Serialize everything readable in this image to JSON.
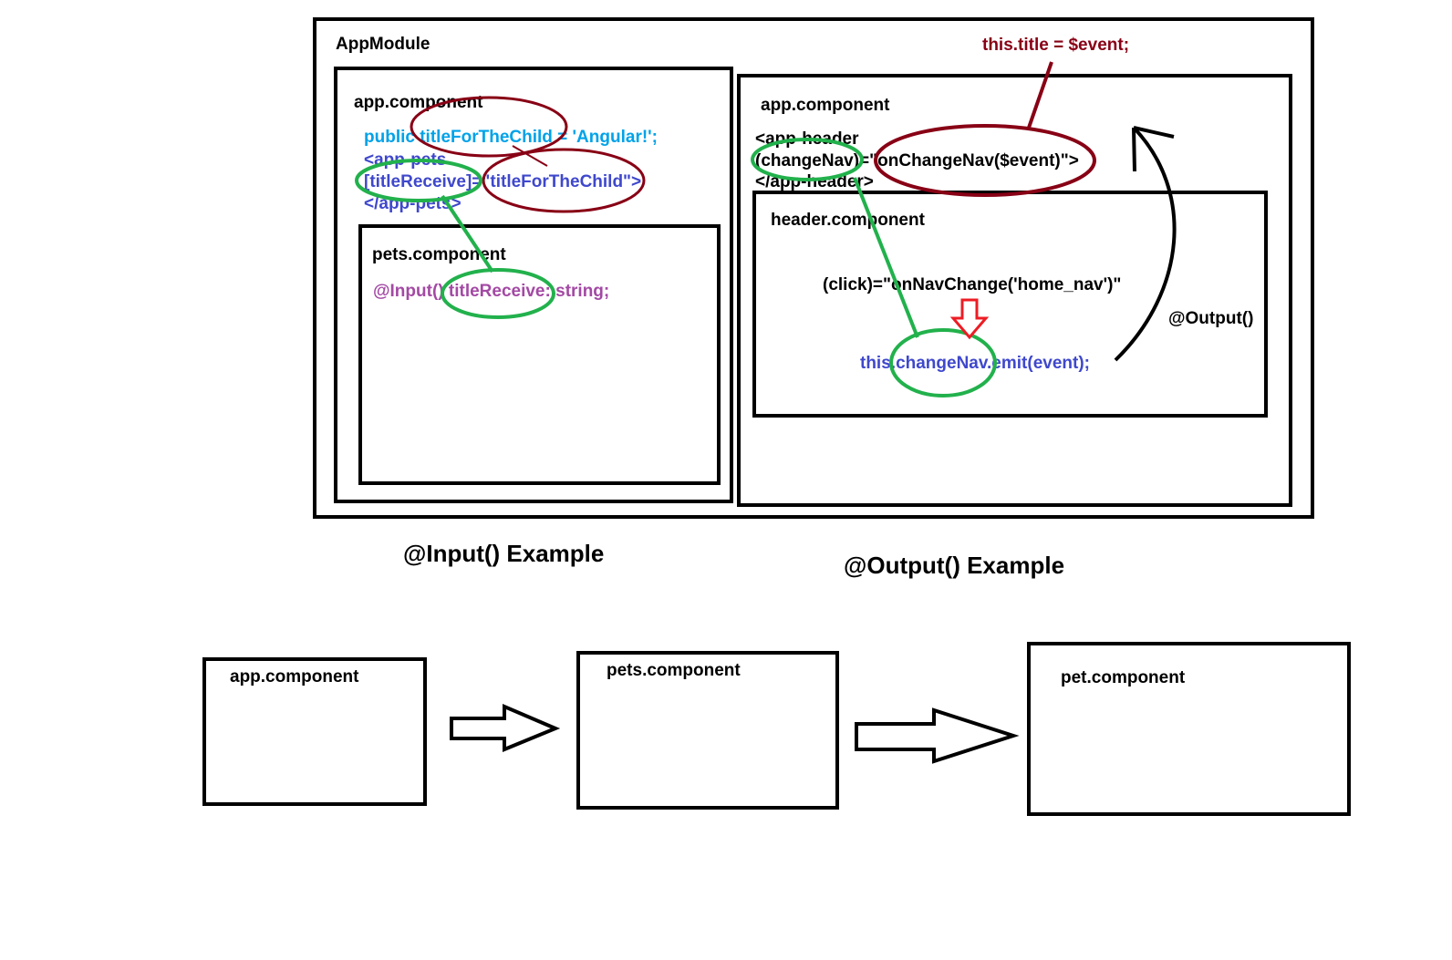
{
  "colors": {
    "code_light": "#00a2e8",
    "code_blue": "#3f48cc",
    "code_purple": "#a349a4",
    "event_red": "#880015",
    "link_green": "#22b14c",
    "arrow_red": "#ed1c24"
  },
  "app_module": {
    "label": "AppModule"
  },
  "input_panel": {
    "component_label": "app.component",
    "line1_keyword": "public",
    "line1_name": "titleForTheChild",
    "line1_value": " = 'Angular!';",
    "line2": "<app-pets",
    "line3_binding": "[titleReceive]",
    "line3_eq": "=",
    "line3_value": "\"titleForTheChild\">",
    "line4": "</app-pets>",
    "child_label": "pets.component",
    "child_decorator": "@Input()",
    "child_prop": "titleReceive",
    "child_type": ": string;"
  },
  "output_panel": {
    "assignment": "this.title = $event;",
    "component_label": "app.component",
    "line1": "<app-header",
    "line2_event": "(changeNav)",
    "line2_eq": "=",
    "line2_handler": "\"onChangeNav($event)\">",
    "line3": "</app-header>",
    "child_label": "header.component",
    "click_line": "(click)=\"onNavChange('home_nav')\"",
    "emit_prefix": "this.",
    "emit_name": "changeNav",
    "emit_suffix": ".emit(event);",
    "decorator_label": "@Output()"
  },
  "captions": {
    "input": "@Input() Example",
    "output": "@Output() Example"
  },
  "flow": {
    "boxes": [
      "app.component",
      "pets.component",
      "pet.component"
    ]
  }
}
